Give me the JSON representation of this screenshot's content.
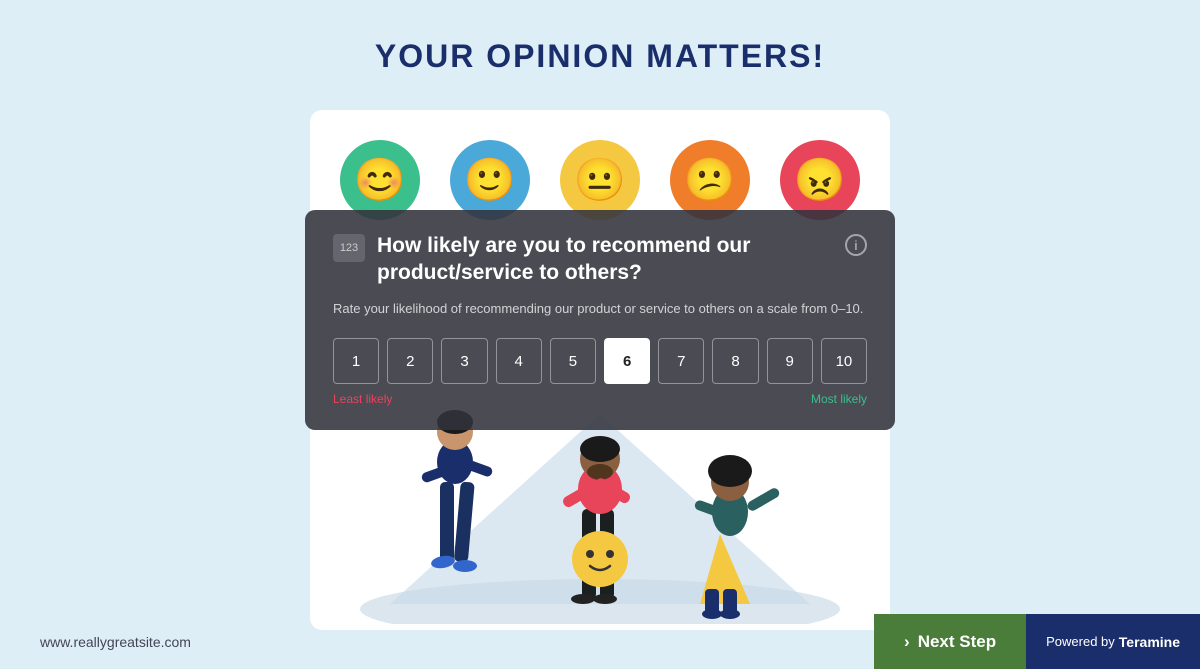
{
  "page": {
    "title": "YOUR OPINION MATTERS!",
    "background_color": "#ddeef7"
  },
  "question_card": {
    "icon_label": "123",
    "question": "How likely are you to recommend our product/service to others?",
    "subtitle": "Rate your likelihood of recommending our product or service to others on a scale from 0–10.",
    "selected_rating": 6,
    "ratings": [
      1,
      2,
      3,
      4,
      5,
      6,
      7,
      8,
      9,
      10
    ],
    "label_least": "Least likely",
    "label_most": "Most likely"
  },
  "emojis": [
    {
      "type": "happy",
      "color": "#3bbf8c",
      "symbol": "😊"
    },
    {
      "type": "slight-smile",
      "color": "#4ba9d9",
      "symbol": "🙂"
    },
    {
      "type": "neutral",
      "color": "#f5c842",
      "symbol": "😐"
    },
    {
      "type": "slight-frown",
      "color": "#f07d2a",
      "symbol": "😕"
    },
    {
      "type": "unhappy",
      "color": "#e8445a",
      "symbol": "😠"
    }
  ],
  "bottom": {
    "website": "www.reallygreatsite.com",
    "next_step_label": "Next Step",
    "powered_by_prefix": "Powered by",
    "brand_name": "Teramine"
  }
}
